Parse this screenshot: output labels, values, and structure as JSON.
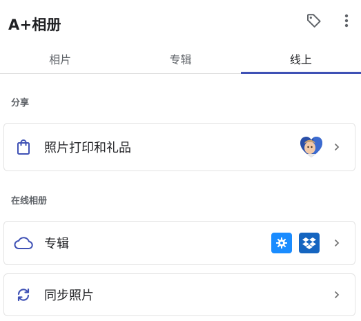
{
  "header": {
    "title": "A+相册",
    "tag_icon": "tag-icon",
    "more_icon": "more-vert-icon"
  },
  "tabs": [
    {
      "label": "相片",
      "active": false
    },
    {
      "label": "专辑",
      "active": false
    },
    {
      "label": "线上",
      "active": true
    }
  ],
  "sections": {
    "share": {
      "label": "分享",
      "items": [
        {
          "label": "照片打印和礼品",
          "icon": "shopping-bag-icon",
          "thumbnail": "child-photo-thumbnail"
        }
      ]
    },
    "online": {
      "label": "在线相册",
      "items": [
        {
          "label": "专辑",
          "icon": "cloud-icon",
          "services": [
            "gear-service-icon",
            "dropbox-icon"
          ]
        },
        {
          "label": "同步照片",
          "icon": "sync-icon"
        }
      ]
    }
  },
  "colors": {
    "accent": "#3f51b5",
    "icon_blue": "#3f51b5",
    "gear_badge": "#1a8cff",
    "dropbox_badge": "#1565c0"
  }
}
